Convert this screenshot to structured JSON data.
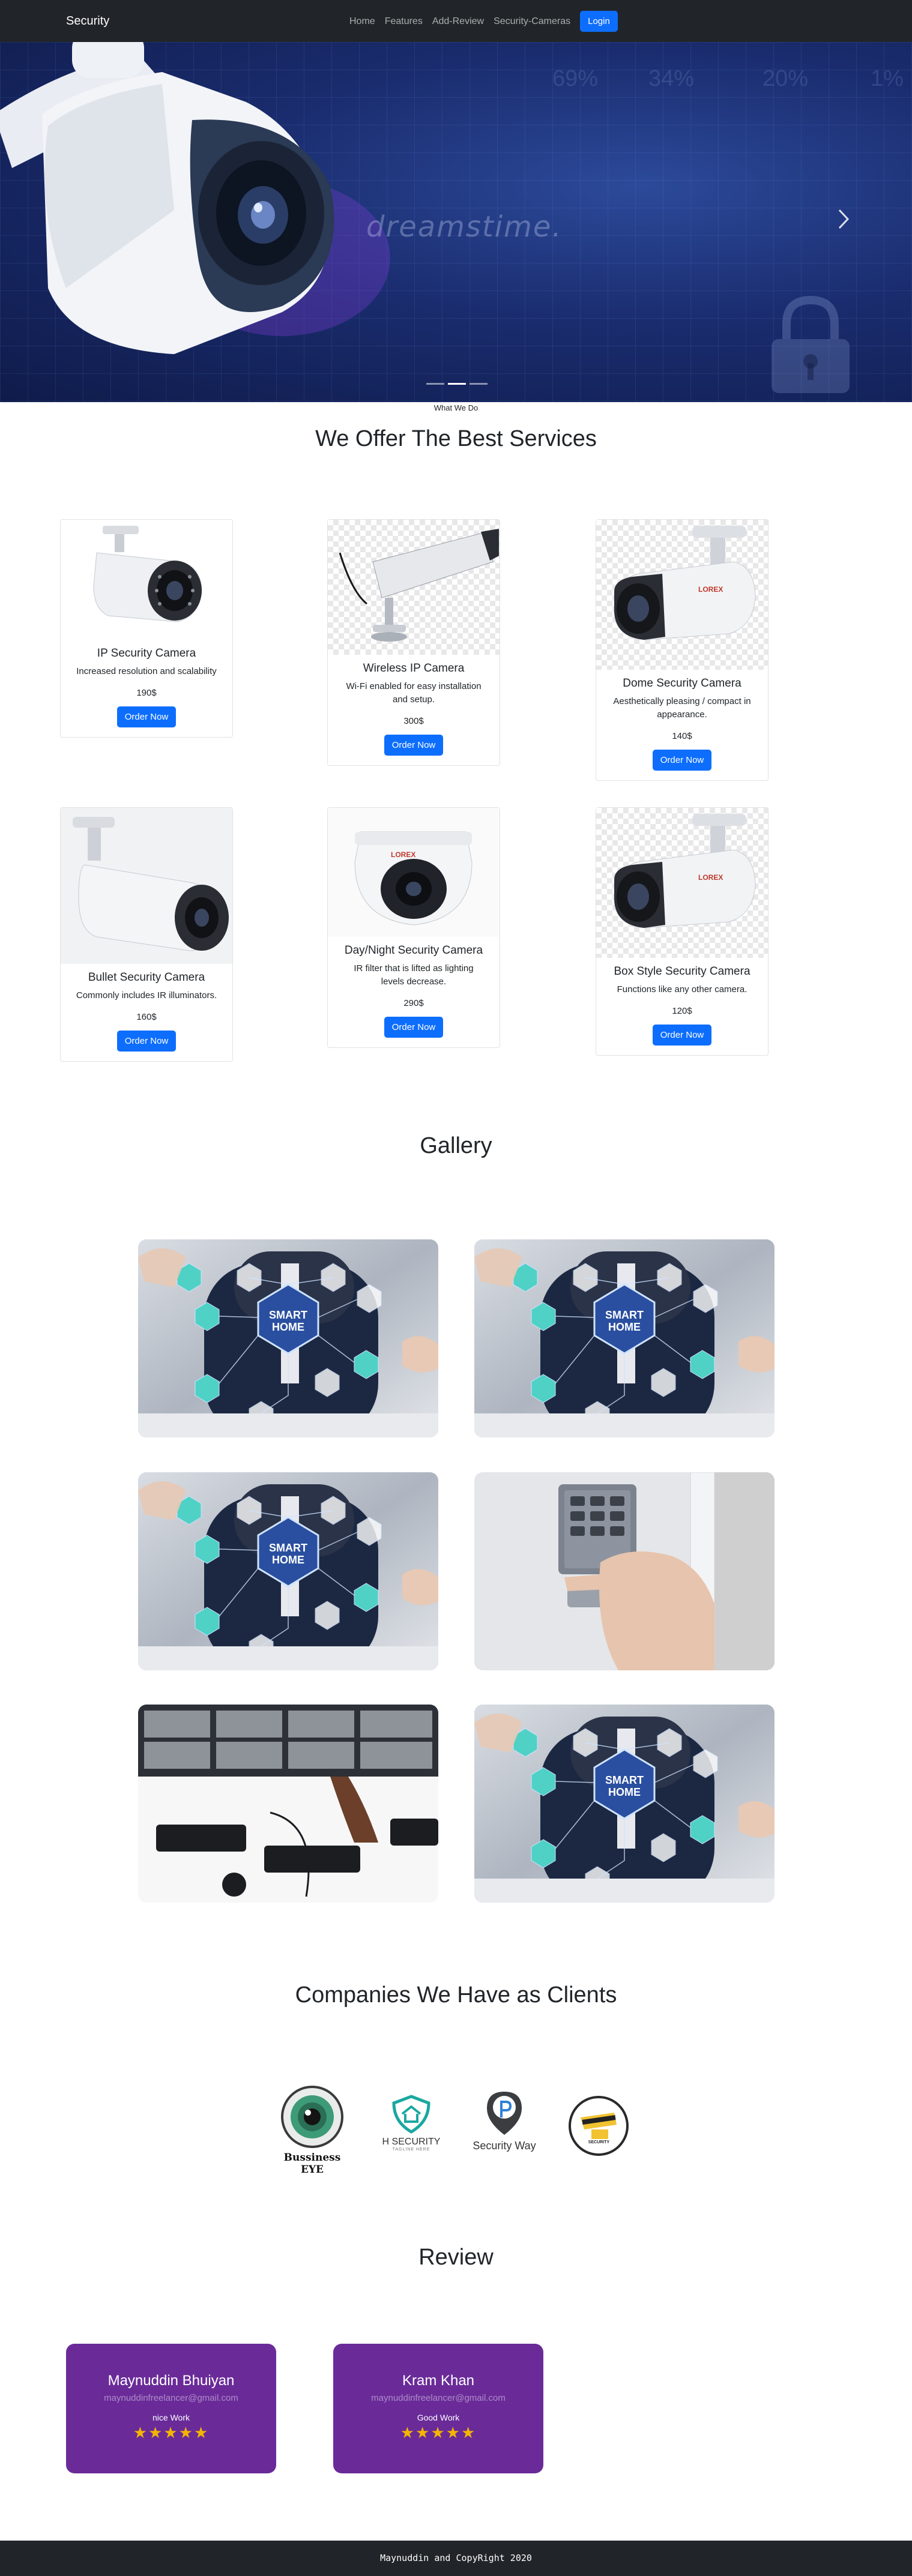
{
  "navbar": {
    "brand": "Security",
    "links": [
      "Home",
      "Features",
      "Add-Review",
      "Security-Cameras"
    ],
    "login": "Login"
  },
  "hero": {
    "watermark": "dreamstime.",
    "percents": [
      "69%",
      "34%",
      "20%",
      "1%"
    ],
    "slide_count": 3,
    "active_slide": 2
  },
  "services": {
    "eyebrow": "What We Do",
    "title": "We Offer The Best Services",
    "items": [
      {
        "name": "IP Security Camera",
        "desc": "Increased resolution and scalability",
        "price": "190$",
        "button": "Order Now"
      },
      {
        "name": "Wireless IP Camera",
        "desc": "Wi-Fi enabled for easy installation and setup.",
        "price": "300$",
        "button": "Order Now"
      },
      {
        "name": "Dome Security Camera",
        "desc": "Aesthetically pleasing / compact in appearance.",
        "price": "140$",
        "button": "Order Now"
      },
      {
        "name": "Bullet Security Camera",
        "desc": "Commonly includes IR illuminators.",
        "price": "160$",
        "button": "Order Now"
      },
      {
        "name": "Day/Night Security Camera",
        "desc": "IR filter that is lifted as lighting levels decrease.",
        "price": "290$",
        "button": "Order Now"
      },
      {
        "name": "Box Style Security Camera",
        "desc": "Functions like any other camera.",
        "price": "120$",
        "button": "Order Now"
      }
    ]
  },
  "gallery": {
    "title": "Gallery",
    "smart_home_label": [
      "SMART",
      "HOME"
    ]
  },
  "clients": {
    "title": "Companies We Have as Clients",
    "logos": [
      {
        "text": "Bussiness EYE",
        "icon": "eye-logo-icon"
      },
      {
        "text": "H SECURITY",
        "sub": "TAGLINE HERE",
        "icon": "shield-logo-icon"
      },
      {
        "text": "Security Way",
        "icon": "p-pin-logo-icon"
      },
      {
        "text": "SECURITY",
        "icon": "camera-badge-logo-icon"
      }
    ]
  },
  "reviews": {
    "title": "Review",
    "items": [
      {
        "name": "Maynuddin Bhuiyan",
        "email": "maynuddinfreelancer@gmail.com",
        "text": "nice Work",
        "stars": "★★★★★",
        "rating": 5
      },
      {
        "name": "Kram Khan",
        "email": "maynuddinfreelancer@gmail.com",
        "text": "Good Work",
        "stars": "★★★★★",
        "rating": 5
      }
    ]
  },
  "footer": {
    "text": "Maynuddin and CopyRight 2020"
  },
  "colors": {
    "primary": "#0d6efd",
    "dark": "#212529",
    "review_bg": "#6a2b99",
    "star": "#f4b400"
  }
}
